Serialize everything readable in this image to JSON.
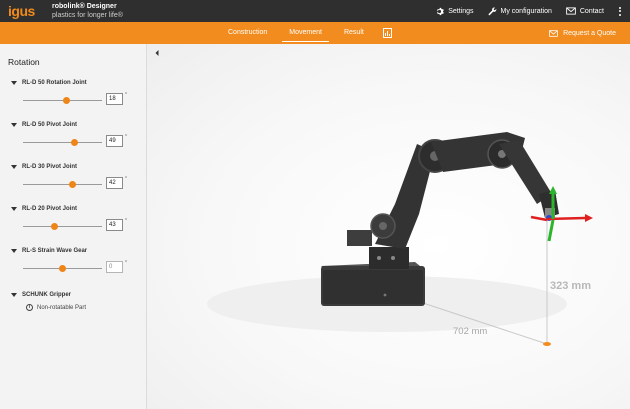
{
  "header": {
    "logo": "igus",
    "app_name": "robolink® Designer",
    "tagline": "plastics for longer life®",
    "actions": [
      {
        "label": "Settings",
        "icon": "gear-icon"
      },
      {
        "label": "My configuration",
        "icon": "wrench-icon"
      },
      {
        "label": "Contact",
        "icon": "envelope-icon"
      }
    ]
  },
  "nav": {
    "tabs": [
      {
        "label": "Construction",
        "active": false
      },
      {
        "label": "Movement",
        "active": true
      },
      {
        "label": "Result",
        "active": false
      }
    ],
    "quote_label": "Request a Quote"
  },
  "sidebar": {
    "title": "Rotation",
    "joints": [
      {
        "label": "RL-D 50 Rotation Joint",
        "value": "18",
        "slider_fraction": 0.55,
        "disabled": false
      },
      {
        "label": "RL-D 50 Pivot Joint",
        "value": "49",
        "slider_fraction": 0.65,
        "disabled": false
      },
      {
        "label": "RL-D 30 Pivot Joint",
        "value": "42",
        "slider_fraction": 0.63,
        "disabled": false
      },
      {
        "label": "RL-D 20 Pivot Joint",
        "value": "43",
        "slider_fraction": 0.4,
        "disabled": false
      },
      {
        "label": "RL-S Strain Wave Gear",
        "value": "0",
        "slider_fraction": 0.5,
        "disabled": true
      }
    ],
    "degree_symbol": "°",
    "gripper": {
      "label": "SCHUNK Gripper",
      "note": "Non-rotatable Part"
    }
  },
  "viewport": {
    "height_label": "323 mm",
    "distance_label": "702 mm"
  },
  "colors": {
    "accent": "#f28c1f",
    "header_bg": "#2f2f2f",
    "axis_x": "#e02020",
    "axis_y": "#2ab52a",
    "axis_z": "#2448d8"
  }
}
